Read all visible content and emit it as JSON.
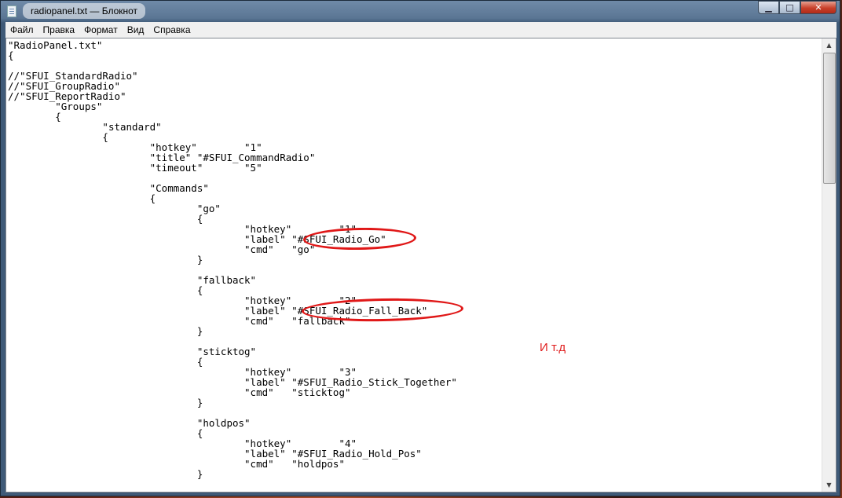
{
  "window": {
    "title": "radiopanel.txt — Блокнот",
    "controls": {
      "minimize": "▁",
      "maximize": "□",
      "close": "✕"
    }
  },
  "menu": [
    "Файл",
    "Правка",
    "Формат",
    "Вид",
    "Справка"
  ],
  "editor": {
    "content": "\"RadioPanel.txt\"\n{\n\n//\"SFUI_StandardRadio\"\n//\"SFUI_GroupRadio\"\n//\"SFUI_ReportRadio\"\n\t\"Groups\"\n\t{\n\t\t\"standard\"\n\t\t{\n\t\t\t\"hotkey\"\t\"1\"\n\t\t\t\"title\" \"#SFUI_CommandRadio\"\n\t\t\t\"timeout\"\t\"5\"\n\n\t\t\t\"Commands\"\n\t\t\t{\n\t\t\t\t\"go\"\n\t\t\t\t{\n\t\t\t\t\t\"hotkey\"\t\"1\"\n\t\t\t\t\t\"label\" \"#SFUI_Radio_Go\"\n\t\t\t\t\t\"cmd\"\t\"go\"\n\t\t\t\t}\n\n\t\t\t\t\"fallback\"\n\t\t\t\t{\n\t\t\t\t\t\"hotkey\"\t\"2\"\n\t\t\t\t\t\"label\" \"#SFUI_Radio_Fall_Back\"\n\t\t\t\t\t\"cmd\"\t\"fallback\"\n\t\t\t\t}\n\n\t\t\t\t\"sticktog\"\n\t\t\t\t{\n\t\t\t\t\t\"hotkey\"\t\"3\"\n\t\t\t\t\t\"label\" \"#SFUI_Radio_Stick_Together\"\n\t\t\t\t\t\"cmd\"\t\"sticktog\"\n\t\t\t\t}\n\n\t\t\t\t\"holdpos\"\n\t\t\t\t{\n\t\t\t\t\t\"hotkey\"\t\"4\"\n\t\t\t\t\t\"label\" \"#SFUI_Radio_Hold_Pos\"\n\t\t\t\t\t\"cmd\"\t\"holdpos\"\n\t\t\t\t}"
  },
  "annotation": {
    "text": "И т.д",
    "color": "#e02020"
  }
}
